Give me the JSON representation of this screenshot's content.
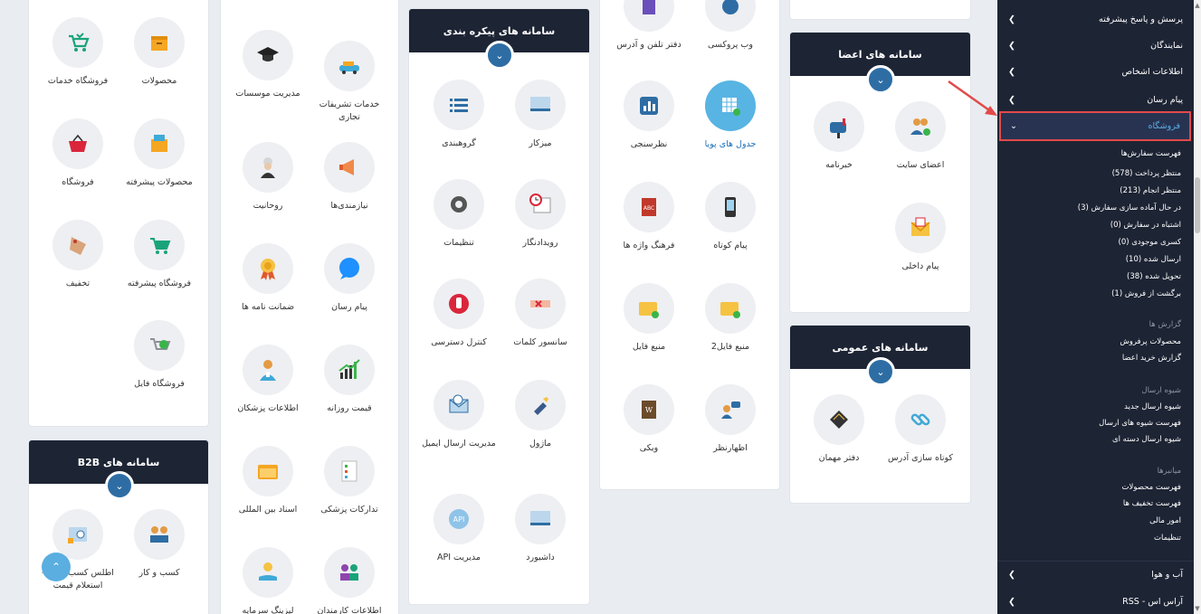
{
  "colors": {
    "sidebar": "#1d2434",
    "accent": "#2e6da4",
    "highlight_box": "#e24a4a",
    "link_blue": "#1d6fb8"
  },
  "col1": {
    "apps": [
      {
        "label": "محصولات",
        "icon": "box-icon"
      },
      {
        "label": "فروشگاه خدمات",
        "icon": "service-cart-icon"
      },
      {
        "label": "محصولات پیشرفته",
        "icon": "advanced-box-icon"
      },
      {
        "label": "فروشگاه",
        "icon": "basket-icon"
      },
      {
        "label": "فروشگاه پیشرفته",
        "icon": "cart-icon"
      },
      {
        "label": "تخفیف",
        "icon": "discount-tag-icon"
      },
      {
        "label": "فروشگاه فایل",
        "icon": "file-store-icon"
      }
    ]
  },
  "b2b": {
    "title": "سامانه های B2B",
    "apps": [
      {
        "label": "کسب و کار",
        "icon": "business-icon"
      },
      {
        "label": "اطلس کسب و کار - استعلام قیمت",
        "icon": "atlas-icon"
      }
    ]
  },
  "col2": {
    "apps": [
      {
        "label": "خدمات تشریفات تجاری",
        "icon": "ceremony-car-icon"
      },
      {
        "label": "مدیریت موسسات",
        "icon": "graduation-cap-icon"
      },
      {
        "label": "نیازمندی‌ها",
        "icon": "megaphone-icon"
      },
      {
        "label": "روحانیت",
        "icon": "cleric-icon"
      },
      {
        "label": "پیام رسان",
        "icon": "chat-bubble-icon"
      },
      {
        "label": "ضمانت نامه ها",
        "icon": "medal-icon"
      },
      {
        "label": "قیمت روزانه",
        "icon": "chart-growth-icon"
      },
      {
        "label": "اطلاعات پزشکان",
        "icon": "doctor-icon"
      },
      {
        "label": "تدارکات پزشکی",
        "icon": "checklist-icon"
      },
      {
        "label": "اسناد بین المللی",
        "icon": "folder-icon"
      },
      {
        "label": "اطلاعات کارمندان",
        "icon": "employees-icon"
      },
      {
        "label": "لیزینگ سرمایه",
        "icon": "leasing-hand-icon"
      }
    ]
  },
  "config": {
    "title": "سامانه های پیکره بندی",
    "apps": [
      {
        "label": "میزکار",
        "icon": "desktop-icon"
      },
      {
        "label": "گروهبندی",
        "icon": "list-icon"
      },
      {
        "label": "رویدادنگار",
        "icon": "calendar-clock-icon"
      },
      {
        "label": "تنظیمات",
        "icon": "gear-icon"
      },
      {
        "label": "سانسور کلمات",
        "icon": "censor-icon"
      },
      {
        "label": "کنترل دسترسی",
        "icon": "stop-hand-icon"
      },
      {
        "label": "ماژول",
        "icon": "module-icon"
      },
      {
        "label": "مدیریت ارسال ایمیل",
        "icon": "email-icon"
      },
      {
        "label": "داشبورد",
        "icon": "dashboard-icon"
      },
      {
        "label": "مدیریت API",
        "icon": "api-gear-icon"
      }
    ]
  },
  "col4": {
    "apps": [
      {
        "label": "وب پروکسی",
        "icon": "proxy-icon"
      },
      {
        "label": "دفتر تلفن و آدرس",
        "icon": "phonebook-icon"
      },
      {
        "label": "جدول های پویا",
        "icon": "table-add-icon",
        "selected": true
      },
      {
        "label": "نظرسنجی",
        "icon": "poll-icon"
      },
      {
        "label": "پیام کوتاه",
        "icon": "mobile-icon"
      },
      {
        "label": "فرهنگ واژه ها",
        "icon": "dictionary-icon"
      },
      {
        "label": "منبع فایل2",
        "icon": "folder-add-icon"
      },
      {
        "label": "منبع فایل",
        "icon": "folder-add-icon"
      },
      {
        "label": "اظهارنظر",
        "icon": "comment-user-icon"
      },
      {
        "label": "ویکی",
        "icon": "wiki-icon"
      }
    ]
  },
  "members": {
    "title": "سامانه های اعضا",
    "apps": [
      {
        "label": "اعضای سایت",
        "icon": "members-add-icon"
      },
      {
        "label": "خبرنامه",
        "icon": "mailbox-icon"
      },
      {
        "label": "پیام داخلی",
        "icon": "envelope-icon"
      }
    ]
  },
  "general": {
    "title": "سامانه های عمومی",
    "apps": [
      {
        "label": "کوتاه سازی آدرس",
        "icon": "link-icon"
      },
      {
        "label": "دفتر مهمان",
        "icon": "guestbook-icon"
      }
    ]
  },
  "sidebar": {
    "top_items": [
      {
        "label": "پرسش و پاسخ پیشرفته"
      },
      {
        "label": "نمایندگان"
      },
      {
        "label": "اطلاعات اشخاص"
      },
      {
        "label": "پیام رسان"
      }
    ],
    "active": {
      "label": "فروشگاه"
    },
    "sub_orders": [
      "فهرست سفارش‌ها",
      "منتظر پرداخت (578)",
      "منتظر انجام (213)",
      "در حال آماده سازی سفارش (3)",
      "اشتباه در سفارش (0)",
      "کسری موجودی (0)",
      "ارسال شده (10)",
      "تحویل شده (38)",
      "برگشت از فروش (1)"
    ],
    "reports_header": "گزارش ها",
    "reports": [
      "محصولات پرفروش",
      "گزارش خرید اعضا"
    ],
    "shipping_header": "شیوه ارسال",
    "shipping": [
      "شیوه ارسال جدید",
      "فهرست شیوه های ارسال",
      "شیوه ارسال دسته ای"
    ],
    "shortcuts_header": "میانبرها",
    "shortcuts": [
      "فهرست محصولات",
      "فهرست تخفیف ها",
      "امور مالی",
      "تنظیمات"
    ],
    "bottom_items": [
      {
        "label": "آب و هوا"
      },
      {
        "label": "آر‌اس اس - RSS"
      }
    ]
  }
}
